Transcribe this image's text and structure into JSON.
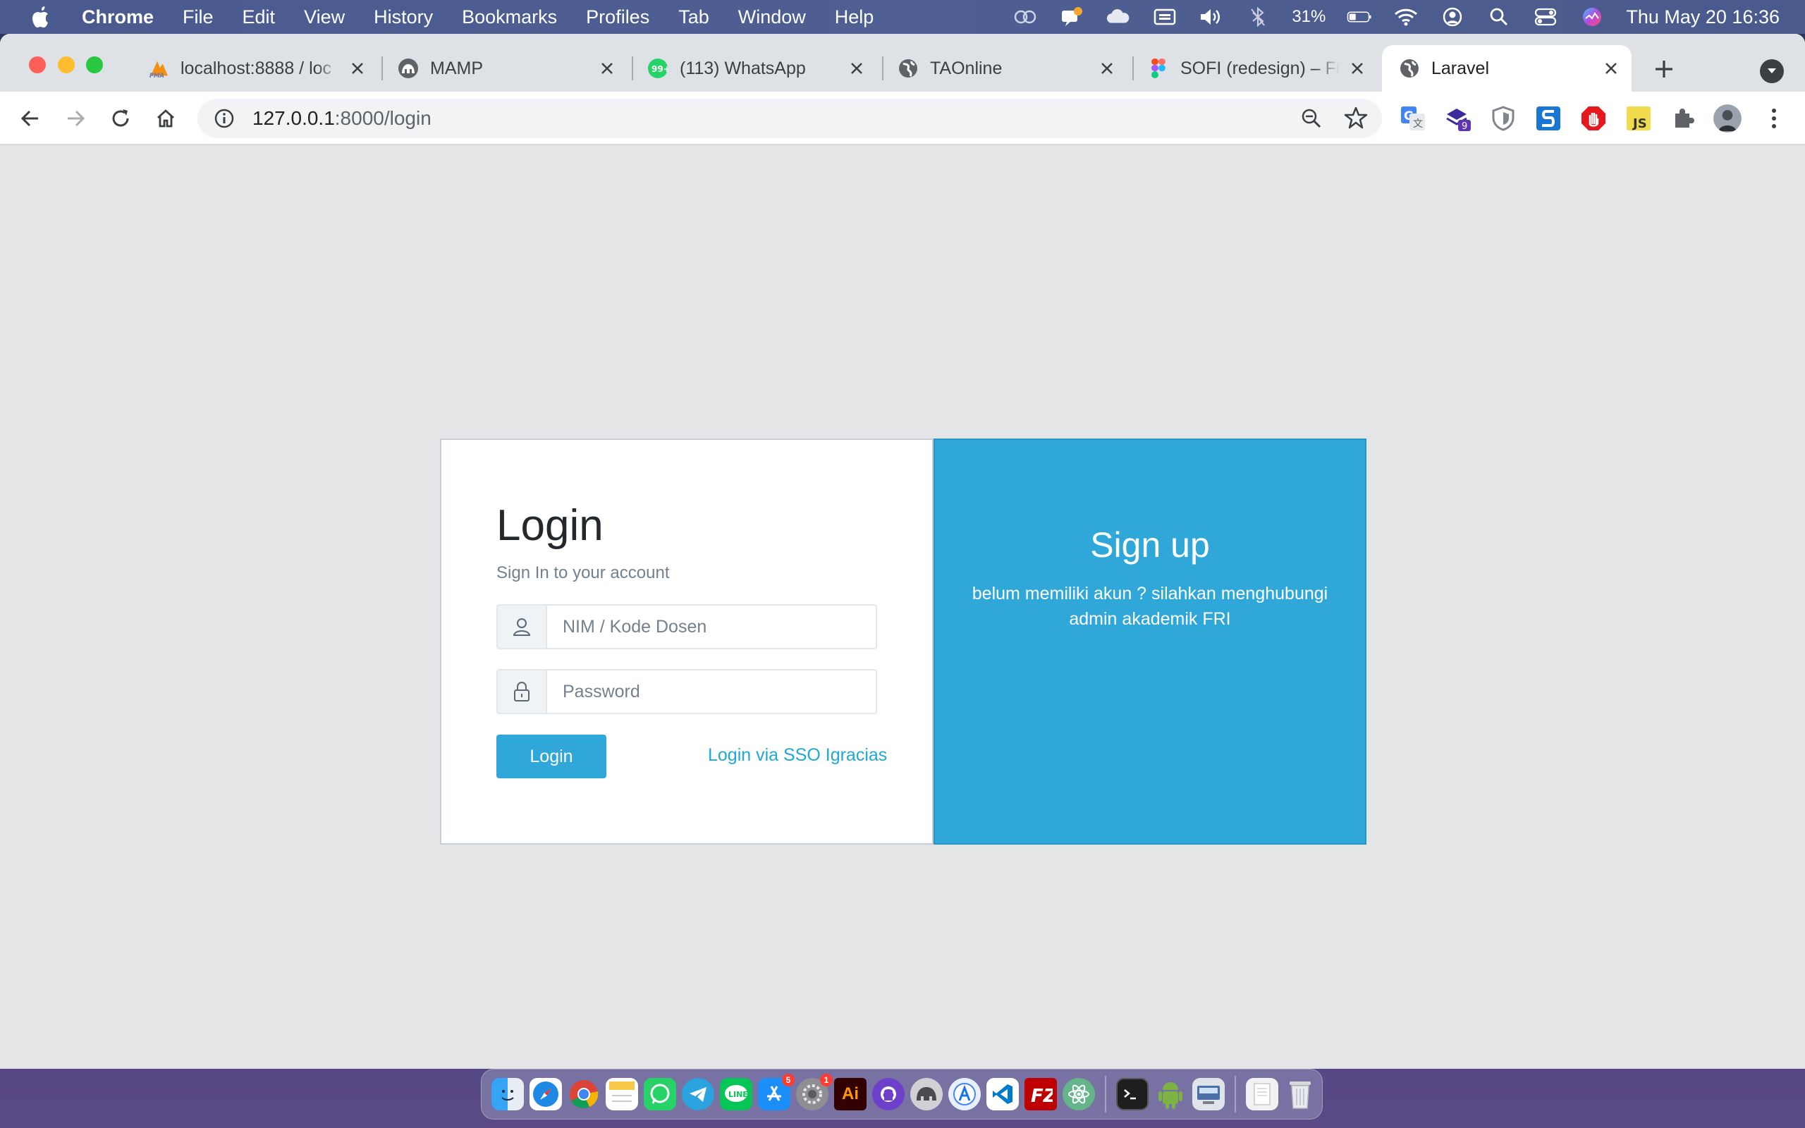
{
  "menubar": {
    "app_name": "Chrome",
    "items": [
      "File",
      "Edit",
      "View",
      "History",
      "Bookmarks",
      "Profiles",
      "Tab",
      "Window",
      "Help"
    ],
    "battery": "31%",
    "clock": "Thu May 20  16:36"
  },
  "tabs": [
    {
      "title": "localhost:8888 / loc",
      "icon": "phpmyadmin-icon",
      "active": false
    },
    {
      "title": "MAMP",
      "icon": "mamp-icon",
      "active": false
    },
    {
      "title": "(113) WhatsApp",
      "icon": "whatsapp-icon",
      "active": false
    },
    {
      "title": "TAOnline",
      "icon": "globe-icon",
      "active": false
    },
    {
      "title": "SOFI (redesign) – Fi",
      "icon": "figma-icon",
      "active": false
    },
    {
      "title": "Laravel",
      "icon": "globe-icon",
      "active": true
    }
  ],
  "address_bar": {
    "host": "127.0.0.1",
    "path": ":8000/login"
  },
  "extensions": {
    "badge_count": "9"
  },
  "login": {
    "title": "Login",
    "subtitle": "Sign In to your account",
    "username_placeholder": "NIM / Kode Dosen",
    "password_placeholder": "Password",
    "login_button": "Login",
    "sso_link": "Login via SSO Igracias"
  },
  "signup": {
    "title": "Sign up",
    "text": "belum memiliki akun ? silahkan menghubungi admin akademik FRI"
  },
  "dock": {
    "appstore_badge": "5",
    "settings_badge": "1",
    "illustrator_label": "Ai"
  },
  "colors": {
    "primary": "#2fa8d9",
    "link": "#20a8d8",
    "page_bg": "#e4e5e6"
  }
}
